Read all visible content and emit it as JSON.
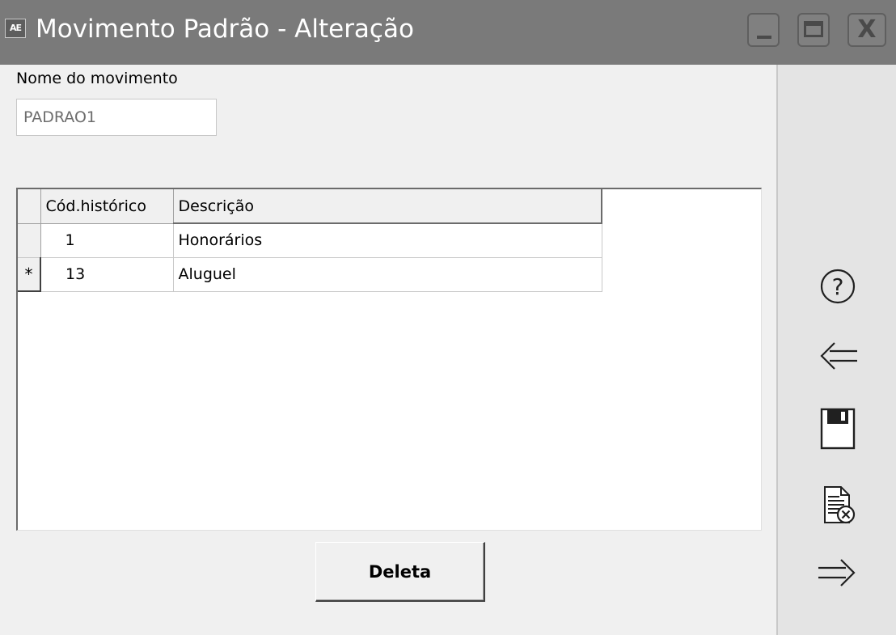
{
  "window": {
    "app_icon_text": "AE",
    "title": "Movimento Padrão - Alteração",
    "controls": {
      "minimize": "minimize-icon",
      "maximize": "maximize-icon",
      "close": "close-icon",
      "close_glyph": "X"
    }
  },
  "form": {
    "name_label": "Nome do movimento",
    "name_value": "PADRAO1"
  },
  "grid": {
    "columns": [
      "Cód.histórico",
      "Descrição"
    ],
    "rows": [
      {
        "indicator": "",
        "cod": "1",
        "descricao": "Honorários"
      },
      {
        "indicator": "*",
        "cod": "13",
        "descricao": "Aluguel"
      }
    ]
  },
  "actions": {
    "delete_label": "Deleta"
  },
  "sidebar": {
    "icons": [
      "help-icon",
      "back-arrow-icon",
      "save-icon",
      "cancel-document-icon",
      "forward-arrow-icon"
    ],
    "help_glyph": "?"
  }
}
